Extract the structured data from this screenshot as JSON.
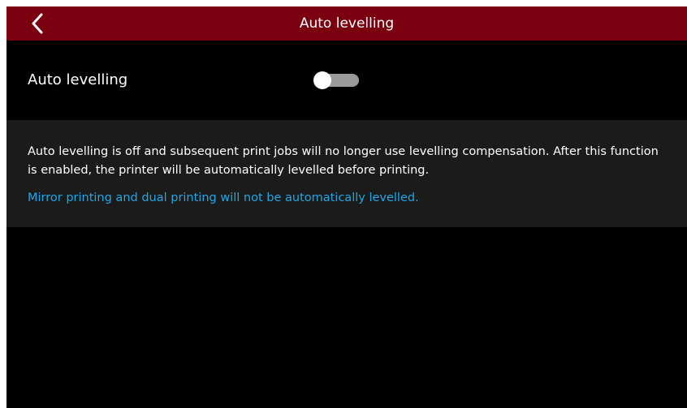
{
  "header": {
    "title": "Auto levelling",
    "back_icon": "chevron-left-icon",
    "background_color": "#7a0010"
  },
  "setting": {
    "label": "Auto levelling",
    "toggle_state": "off"
  },
  "info": {
    "description": "Auto levelling is off and subsequent print jobs will no longer use levelling compensation. After this function is enabled, the printer will be automatically levelled before printing.",
    "note": "Mirror printing and dual printing will not be automatically levelled.",
    "note_color": "#1fa7e6"
  }
}
